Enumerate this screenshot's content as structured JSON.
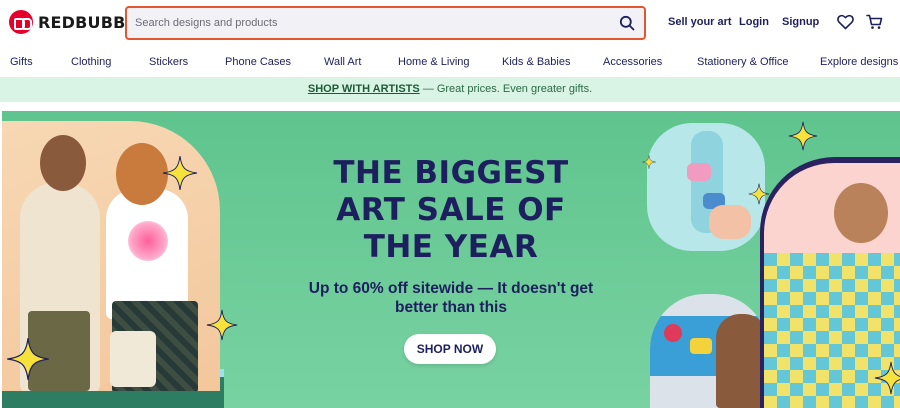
{
  "header": {
    "logo_text": "REDBUBBLE",
    "search_placeholder": "Search designs and products",
    "links": {
      "sell": "Sell your art",
      "login": "Login",
      "signup": "Signup"
    },
    "icons": [
      "search-icon",
      "heart-icon",
      "cart-icon"
    ]
  },
  "nav": {
    "items": [
      "Gifts",
      "Clothing",
      "Stickers",
      "Phone Cases",
      "Wall Art",
      "Home & Living",
      "Kids & Babies",
      "Accessories",
      "Stationery & Office",
      "Explore designs"
    ]
  },
  "promo": {
    "link": "SHOP WITH ARTISTS",
    "text": " — Great prices. Even greater gifts."
  },
  "hero": {
    "title": "THE BIGGEST ART SALE OF THE YEAR",
    "subtitle": "Up to 60% off sitewide — It doesn't get better than this",
    "cta": "SHOP NOW"
  },
  "colors": {
    "brand_red": "#e4002b",
    "navy": "#1d1f5e",
    "promo_bg": "#d9f3e4",
    "hero_green": "#6fcd9a",
    "sparkle_yellow": "#f6e23b"
  }
}
